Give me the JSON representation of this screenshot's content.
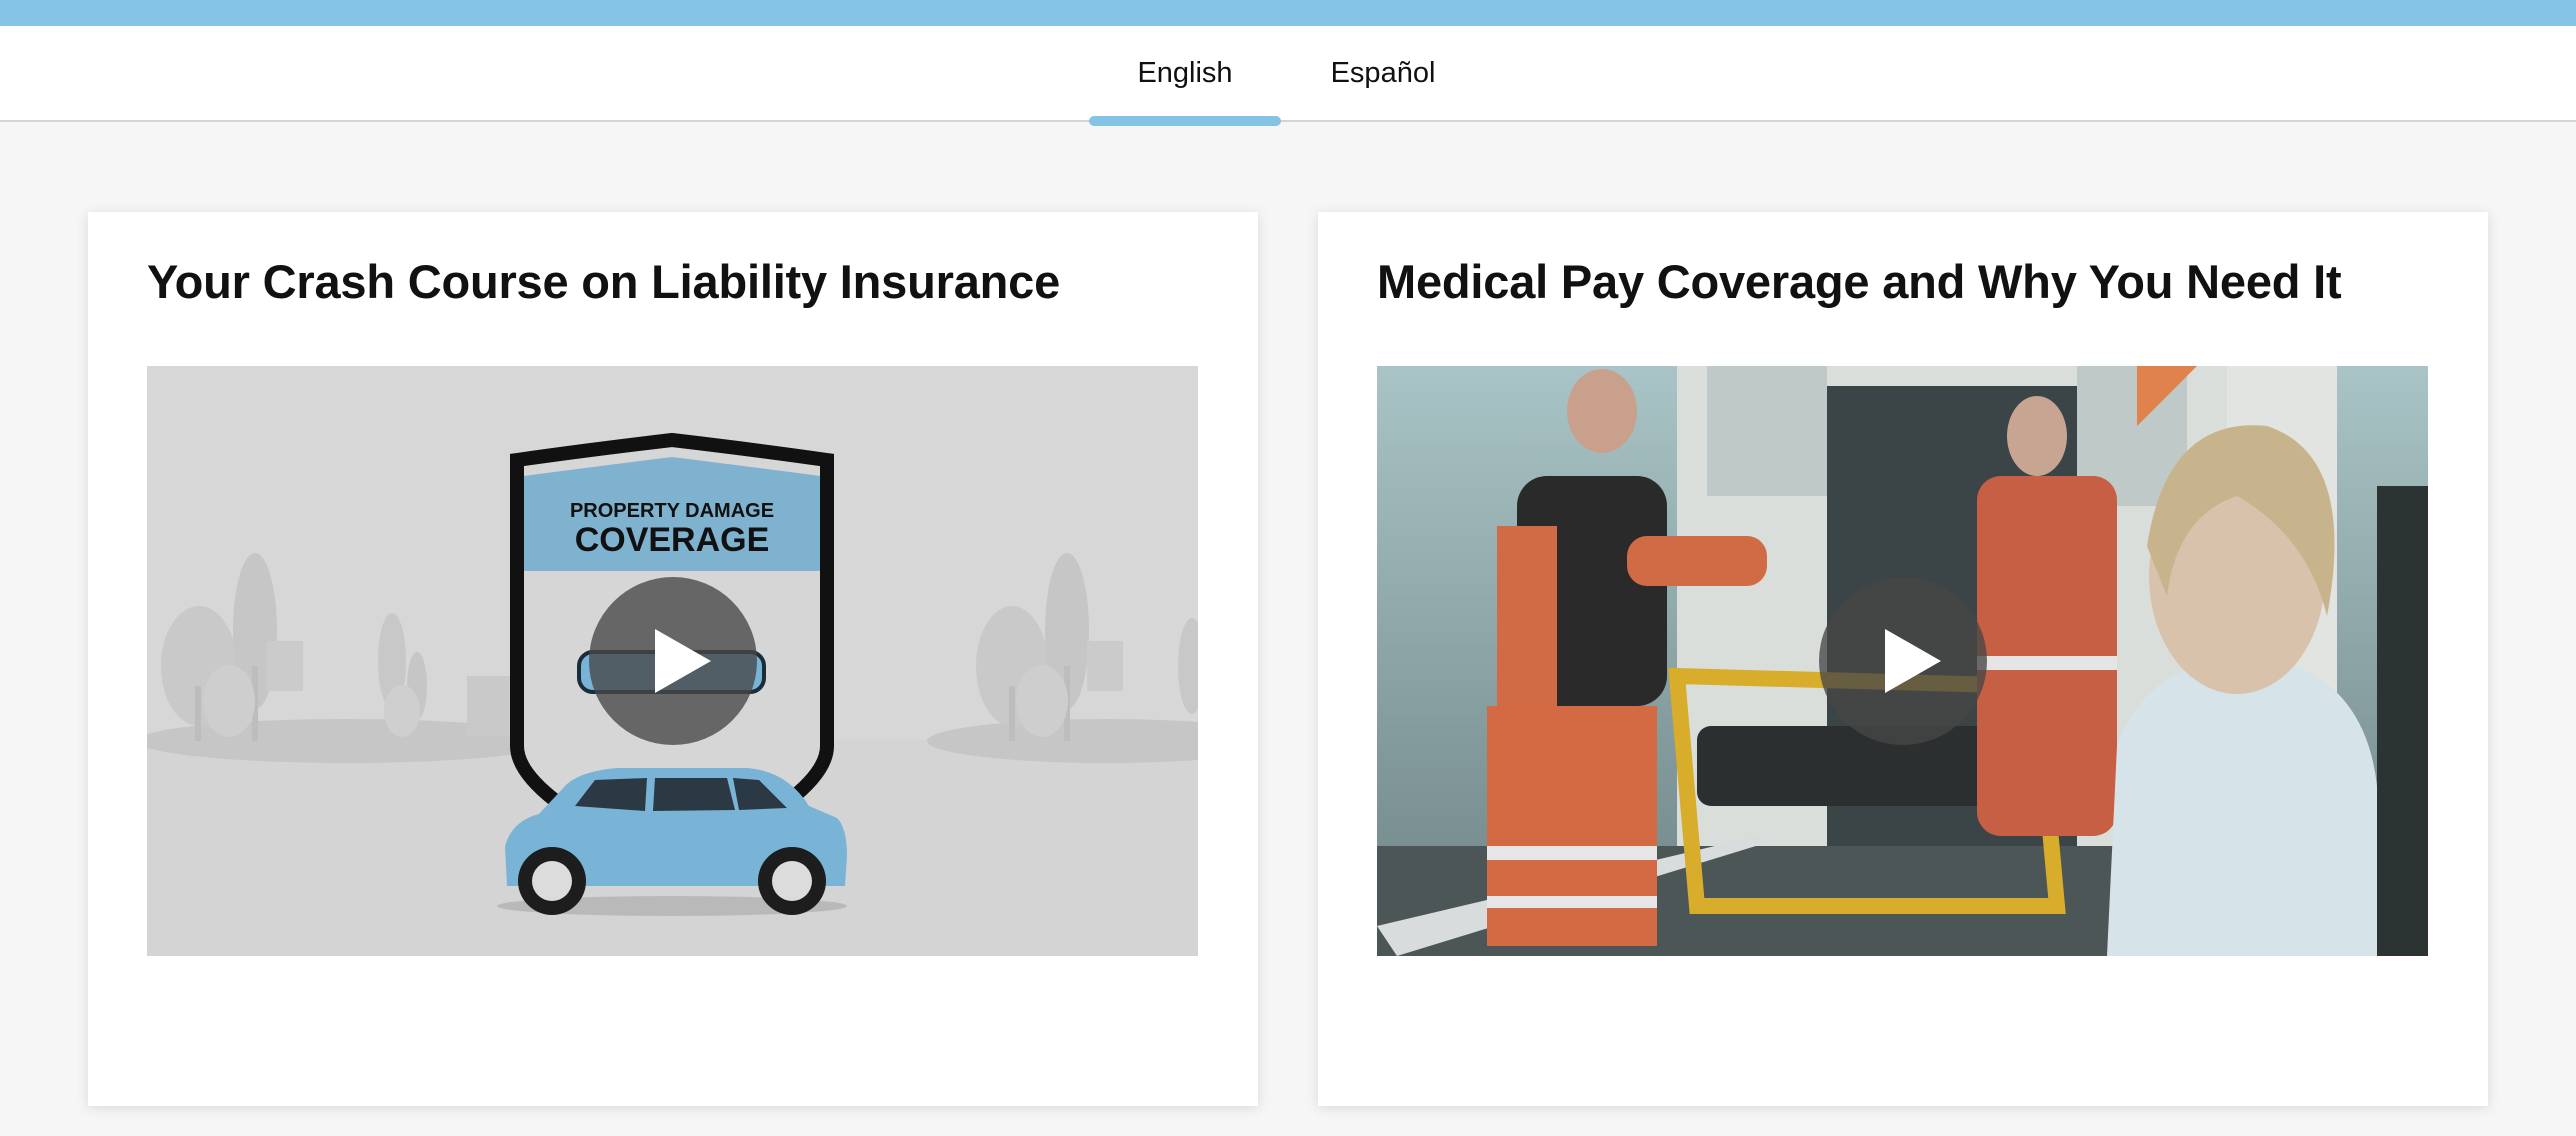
{
  "tabs": [
    {
      "label": "English",
      "selected": true
    },
    {
      "label": "Español",
      "selected": false
    }
  ],
  "videos": [
    {
      "title": "Your Crash Course on Liability Insurance",
      "thumbnail": {
        "line1": "PROPERTY DAMAGE",
        "line2": "COVERAGE"
      },
      "play_icon": "play-icon"
    },
    {
      "title": "Medical Pay Coverage and Why You Need It",
      "play_icon": "play-icon"
    }
  ],
  "colors": {
    "accent": "#84c3e3",
    "shield_blue": "#7fb2cf",
    "car_blue": "#79b3d6"
  }
}
